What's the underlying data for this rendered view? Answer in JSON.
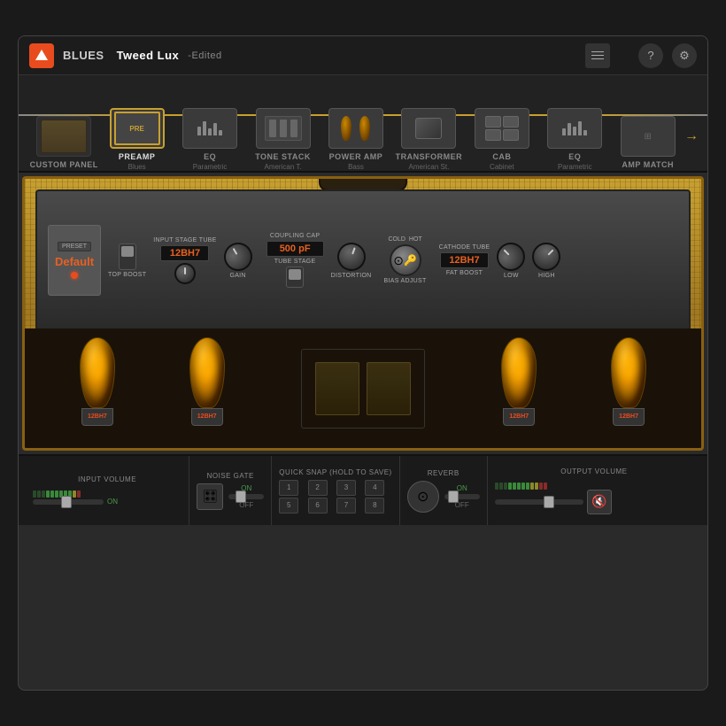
{
  "header": {
    "genre_label": "BLUES",
    "preset_name": "Tweed Lux",
    "edited_label": "-Edited",
    "help_icon": "?",
    "settings_icon": "⚙"
  },
  "chain": {
    "items": [
      {
        "id": "custom-panel",
        "label": "CUSTOM PANEL",
        "sublabel": "",
        "active": false
      },
      {
        "id": "preamp",
        "label": "PREAMP",
        "sublabel": "Blues",
        "active": true
      },
      {
        "id": "eq1",
        "label": "EQ",
        "sublabel": "Parametric",
        "active": false
      },
      {
        "id": "tone-stack",
        "label": "TONE STACK",
        "sublabel": "American T.",
        "active": false
      },
      {
        "id": "power-amp",
        "label": "POWER AMP",
        "sublabel": "Bass",
        "active": false
      },
      {
        "id": "transformer",
        "label": "TRANSFORMER",
        "sublabel": "American St.",
        "active": false
      },
      {
        "id": "cab",
        "label": "CAB",
        "sublabel": "Cabinet",
        "active": false
      },
      {
        "id": "eq2",
        "label": "EQ",
        "sublabel": "Parametric",
        "active": false
      },
      {
        "id": "amp-match",
        "label": "AMP MATCH",
        "sublabel": "",
        "active": false
      }
    ]
  },
  "amp": {
    "preset_label": "PRESET",
    "preset_value": "Default",
    "input_stage_label": "INPUT STAGE TUBE",
    "input_stage_value": "12BH7",
    "coupling_cap_label": "COUPLING CAP",
    "coupling_cap_value": "500 pF",
    "tube_stage_label": "TUBE STAGE",
    "cold_label": "COLD",
    "hot_label": "HOT",
    "bias_adjust_label": "BIAS ADJUST",
    "cathode_tube_label": "CATHODE TUBE",
    "cathode_tube_value": "12BH7",
    "fat_boost_label": "FAT BOOST",
    "top_boost_label": "TOP BOOST",
    "gain_label": "GAIN",
    "distortion_label": "DISTORTION",
    "low_label": "LOW",
    "high_label": "HIGH",
    "tubes": [
      "12BH7",
      "12BH7",
      "12BH7",
      "12BH7"
    ]
  },
  "bottom": {
    "input_volume_label": "INPUT VOLUME",
    "noise_gate_label": "NOISE GATE",
    "quick_snap_label": "QUICK SNAP (Hold to Save)",
    "reverb_label": "REVERB",
    "output_volume_label": "OUTPUT VOLUME",
    "on_label": "ON",
    "off_label": "OFF",
    "mute_label": "MUTE",
    "snap_buttons": [
      "1",
      "2",
      "3",
      "4",
      "5",
      "6",
      "7",
      "8"
    ]
  }
}
